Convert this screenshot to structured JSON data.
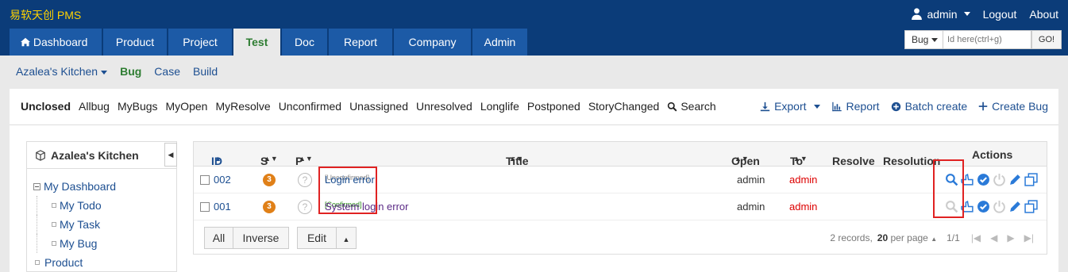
{
  "app": {
    "brand": "易软天创 PMS"
  },
  "user": {
    "name": "admin",
    "logout": "Logout",
    "about": "About"
  },
  "main_tabs": [
    "Dashboard",
    "Product",
    "Project",
    "Test",
    "Doc",
    "Report",
    "Company",
    "Admin"
  ],
  "search": {
    "type": "Bug",
    "placeholder": "Id here(ctrl+g)",
    "go": "GO!"
  },
  "subnav": {
    "product": "Azalea's Kitchen",
    "items": [
      "Bug",
      "Case",
      "Build"
    ]
  },
  "filters": [
    "Unclosed",
    "Allbug",
    "MyBugs",
    "MyOpen",
    "MyResolve",
    "Unconfirmed",
    "Unassigned",
    "Unresolved",
    "Longlife",
    "Postponed",
    "StoryChanged"
  ],
  "filter_search": "Search",
  "toolbar": {
    "export": "Export",
    "report": "Report",
    "batch_create": "Batch create",
    "create_bug": "Create Bug"
  },
  "sidebar": {
    "title": "Azalea's Kitchen",
    "tree": [
      "My Dashboard",
      "My Todo",
      "My Task",
      "My Bug",
      "Product"
    ]
  },
  "table": {
    "headers": {
      "id": "ID",
      "s": "S",
      "p": "P",
      "title": "Title",
      "open": "Open",
      "to": "To",
      "resolve": "Resolve",
      "resolution": "Resolution",
      "actions": "Actions"
    },
    "rows": [
      {
        "id": "002",
        "severity": "3",
        "priority": "?",
        "tag": "[Unconfirmed]",
        "title": "Login error",
        "open": "admin",
        "to": "admin"
      },
      {
        "id": "001",
        "severity": "3",
        "priority": "?",
        "tag": "[Confirmed]",
        "title": "System login error",
        "open": "admin",
        "to": "admin"
      }
    ]
  },
  "footer": {
    "all": "All",
    "inverse": "Inverse",
    "edit": "Edit",
    "records_prefix": "2 records,",
    "per_page_num": "20",
    "per_page_label": "per page",
    "page": "1/1"
  },
  "colors": {
    "header_bg": "#0b3c79",
    "tab_bg": "#1c5aa6",
    "active_green": "#2e7d32",
    "link": "#1d4f91",
    "highlight": "#e02222"
  }
}
